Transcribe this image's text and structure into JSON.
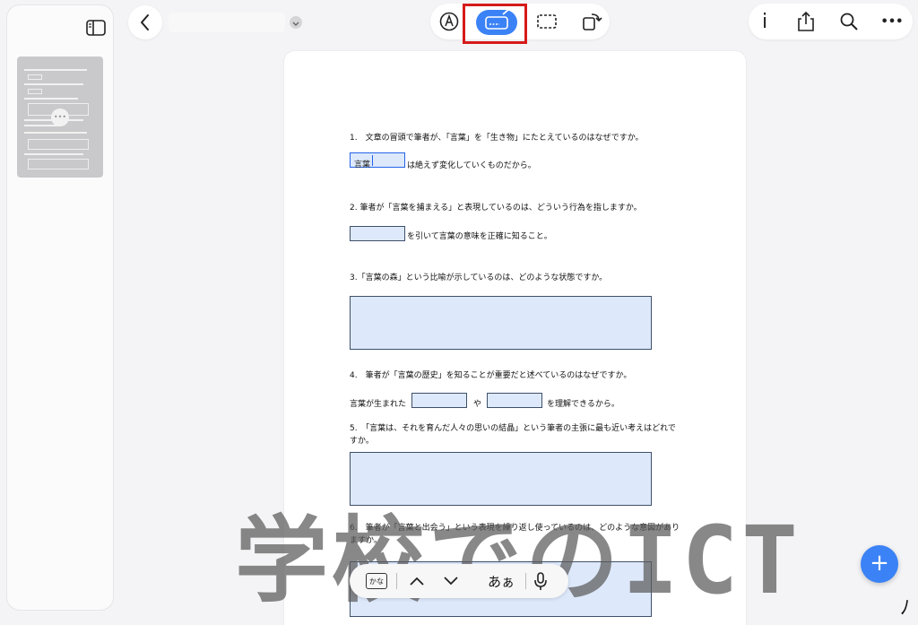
{
  "toolbar": {
    "left": {
      "back": "back",
      "dropdown": "chevron-down"
    },
    "center": [
      "pen-icon",
      "keyboard-text-icon",
      "select-rect-icon",
      "rotate-page-icon"
    ],
    "right": [
      "info-icon",
      "share-icon",
      "search-icon",
      "more-icon"
    ],
    "info_label": "i",
    "more_label": "•••"
  },
  "sidebar": {
    "thumb_more_label": "•••"
  },
  "questions": [
    {
      "label": "1.　文章の冒頭で筆者が、「言葉」を「生き物」にたとえているのはなぜですか。"
    },
    {
      "label": "2. 筆者が「言葉を捕まえる」と表現しているのは、どういう行為を指しますか。"
    },
    {
      "label": "3.「言葉の森」という比喩が示しているのは、どのような状態ですか。"
    },
    {
      "label": "4.　筆者が「言葉の歴史」を知ることが重要だと述べているのはなぜですか。"
    },
    {
      "label": "5.　「言葉は、それを育んだ人々の思いの結晶」という筆者の主張に最も近い考えはどれですか。"
    },
    {
      "label": "6.　筆者が「言葉と出会う」という表現を繰り返し使っているのは、どのような意図がありますか。"
    }
  ],
  "answers": {
    "q1_value": "言葉",
    "q1_after": "は絶えず変化していくものだから。",
    "q2_after": "を引いて言葉の意味を正確に知ること。",
    "q4_before": "言葉が生まれた",
    "q4_mid": "や",
    "q4_after": "を理解できるから。"
  },
  "watermark": "学校でのICT",
  "keyboard_bar": {
    "kana_label": "かな",
    "aa_label": "あぁ"
  },
  "fab_label": "+",
  "corner_glyph": "ﾉ",
  "colors": {
    "accent": "#3b82f6",
    "highlight_box": "#d61a1a",
    "field_fill": "#dde9fb"
  }
}
